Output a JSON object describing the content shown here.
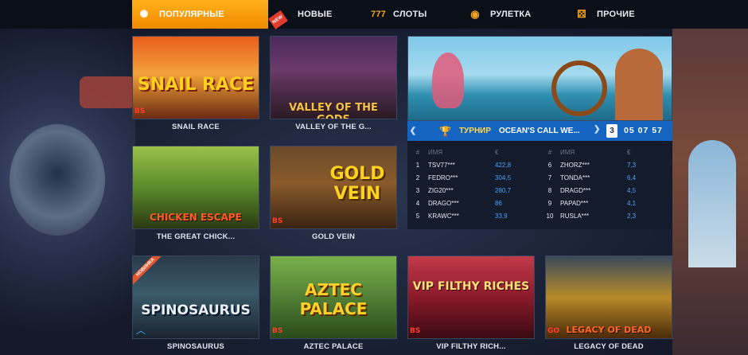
{
  "nav": {
    "items": [
      {
        "label": "ПОПУЛЯРНЫЕ",
        "icon": "popular-icon",
        "active": true
      },
      {
        "label": "НОВЫЕ",
        "icon": "new-icon",
        "active": false
      },
      {
        "label": "СЛОТЫ",
        "icon": "slots-777-icon",
        "active": false
      },
      {
        "label": "РУЛЕТКА",
        "icon": "roulette-icon",
        "active": false
      },
      {
        "label": "ПРОЧИЕ",
        "icon": "dice-icon",
        "active": false
      }
    ],
    "new_badge": "NEW"
  },
  "games": [
    {
      "name": "SNAIL RACE",
      "logo": "SNAIL RACE",
      "provider": "BS"
    },
    {
      "name": "VALLEY OF THE G...",
      "logo": "VALLEY OF THE GODS"
    },
    {
      "name": "THE GREAT CHICK...",
      "logo": "CHICKEN ESCAPE"
    },
    {
      "name": "GOLD VEIN",
      "logo": "GOLD VEIN",
      "provider": "BS"
    },
    {
      "name": "SPINOSAURUS",
      "logo": "SPINOSAURUS",
      "ribbon": "НОВИНКА"
    },
    {
      "name": "AZTEC PALACE",
      "logo": "AZTEC PALACE",
      "provider": "BS"
    },
    {
      "name": "VIP FILTHY RICH...",
      "logo": "VIP FILTHY RICHES",
      "provider": "BS"
    },
    {
      "name": "LEGACY OF DEAD",
      "logo": "LEGACY OF DEAD",
      "provider": "GO"
    }
  ],
  "tournament": {
    "label": "ТУРНИР",
    "title": "OCEAN'S CALL WE...",
    "days": "3",
    "timer": "05 07 57",
    "headers": {
      "pos": "#",
      "name": "ИМЯ",
      "score": "€"
    },
    "left": [
      {
        "pos": "1",
        "name": "TSV77***",
        "score": "422,8"
      },
      {
        "pos": "2",
        "name": "FEDRO***",
        "score": "304,5"
      },
      {
        "pos": "3",
        "name": "ZIG20***",
        "score": "280,7"
      },
      {
        "pos": "4",
        "name": "DRAGO***",
        "score": "86"
      },
      {
        "pos": "5",
        "name": "KRAWC***",
        "score": "33,9"
      }
    ],
    "right": [
      {
        "pos": "6",
        "name": "ZHORZ***",
        "score": "7,3"
      },
      {
        "pos": "7",
        "name": "TONDA***",
        "score": "6,4"
      },
      {
        "pos": "8",
        "name": "DRAGD***",
        "score": "4,5"
      },
      {
        "pos": "9",
        "name": "PAPAD***",
        "score": "4,1"
      },
      {
        "pos": "10",
        "name": "RUSLA***",
        "score": "2,3"
      }
    ]
  },
  "colors": {
    "accent": "#f5a623",
    "tourney_bar": "#1565c0",
    "score": "#4aa3ff"
  }
}
